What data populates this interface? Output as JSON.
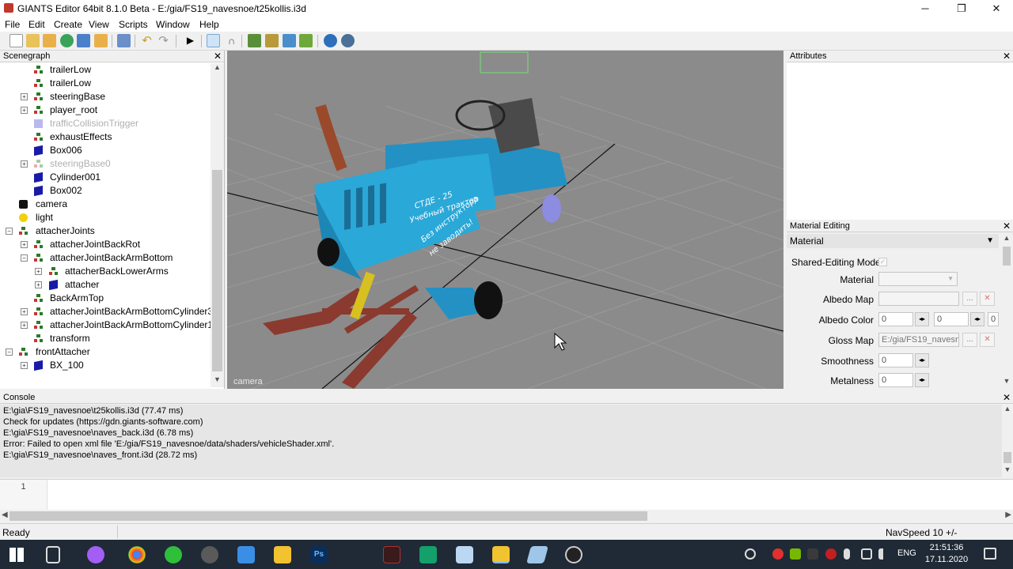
{
  "window": {
    "title": "GIANTS Editor 64bit 8.1.0 Beta - E:/gia/FS19_navesnoe/t25kollis.i3d",
    "minimize": "─",
    "restore": "❐",
    "close": "✕"
  },
  "menu": [
    "File",
    "Edit",
    "Create",
    "View",
    "Scripts",
    "Window",
    "Help"
  ],
  "scenegraph": {
    "title": "Scenegraph",
    "close": "✕",
    "nodes": [
      {
        "label": "trailerLow",
        "icon": "transform-group-icon"
      },
      {
        "label": "trailerLow",
        "icon": "transform-group-icon"
      },
      {
        "label": "steeringBase",
        "icon": "transform-group-icon"
      },
      {
        "label": "player_root",
        "icon": "transform-group-icon"
      },
      {
        "label": "trafficCollisionTrigger",
        "icon": "shape-icon"
      },
      {
        "label": "exhaustEffects",
        "icon": "transform-group-icon"
      },
      {
        "label": "Box006",
        "icon": "shape-icon"
      },
      {
        "label": "steeringBase0",
        "icon": "transform-group-icon"
      },
      {
        "label": "Cylinder001",
        "icon": "shape-icon"
      },
      {
        "label": "Box002",
        "icon": "shape-icon"
      },
      {
        "label": "camera",
        "icon": "camera-icon"
      },
      {
        "label": "light",
        "icon": "light-icon"
      },
      {
        "label": "attacherJoints",
        "icon": "transform-group-icon"
      },
      {
        "label": "attacherJointBackRot",
        "icon": "transform-group-icon"
      },
      {
        "label": "attacherJointBackArmBottom",
        "icon": "transform-group-icon"
      },
      {
        "label": "attacherBackLowerArms",
        "icon": "transform-group-icon"
      },
      {
        "label": "attacher",
        "icon": "shape-icon"
      },
      {
        "label": "BackArmTop",
        "icon": "transform-group-icon"
      },
      {
        "label": "attacherJointBackArmBottomCylinder3",
        "icon": "transform-group-icon"
      },
      {
        "label": "attacherJointBackArmBottomCylinder1",
        "icon": "transform-group-icon"
      },
      {
        "label": "transform",
        "icon": "transform-group-icon"
      },
      {
        "label": "frontAttacher",
        "icon": "transform-group-icon"
      },
      {
        "label": "BX_100",
        "icon": "shape-icon"
      }
    ]
  },
  "viewport": {
    "camera_label": "camera",
    "decal_lines": [
      "СТДЕ - 25",
      "Учебный трактор",
      "Без инструктора",
      "не заводить!"
    ]
  },
  "attributes": {
    "title": "Attributes",
    "close": "✕"
  },
  "material_editing": {
    "title": "Material Editing",
    "close": "✕",
    "section": "Material",
    "shared_editing_label": "Shared-Editing Mode",
    "material_label": "Material",
    "albedo_map_label": "Albedo Map",
    "albedo_color_label": "Albedo Color",
    "albedo_color_r": "0",
    "albedo_color_g": "0",
    "albedo_color_b": "0",
    "gloss_map_label": "Gloss Map",
    "gloss_map_value": "E:/gia/FS19_navesn",
    "smoothness_label": "Smoothness",
    "smoothness_value": "0",
    "metalness_label": "Metalness",
    "metalness_value": "0",
    "browse": "...",
    "clear": "✕"
  },
  "console": {
    "title": "Console",
    "close": "✕",
    "lines": [
      "E:\\gia\\FS19_navesnoe\\t25kollis.i3d (77.47 ms)",
      "Check for updates (https://gdn.giants-software.com)",
      "E:\\gia\\FS19_navesnoe\\naves_back.i3d (6.78 ms)",
      "Error: Failed to open xml file 'E:/gia/FS19_navesnoe/data/shaders/vehicleShader.xml'.",
      "E:\\gia\\FS19_navesnoe\\naves_front.i3d (28.72 ms)"
    ],
    "script_line_number": "1"
  },
  "status": {
    "left": "Ready",
    "right": "NavSpeed 10 +/-"
  },
  "taskbar": {
    "language": "ENG",
    "time": "21:51:36",
    "date": "17.11.2020"
  },
  "colors": {
    "tractor_body": "#2aa8d8",
    "sled_rails": "#8a3a2e",
    "viewport_bg": "#8b8b8b",
    "taskbar_bg": "#1f2a36"
  }
}
